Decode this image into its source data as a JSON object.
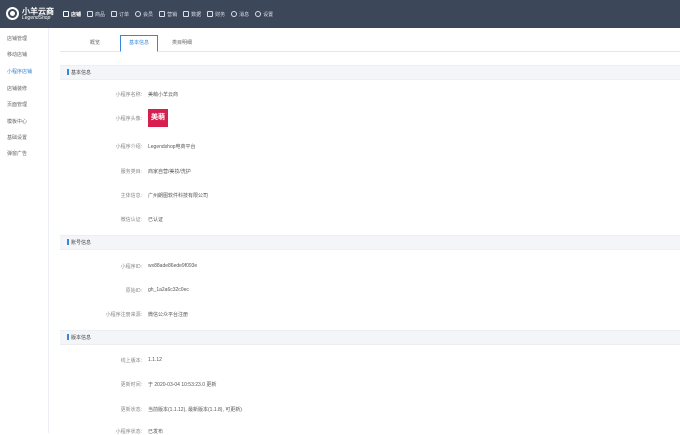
{
  "app": {
    "logo_title": "小羊云商",
    "logo_subtitle": "LegendShop"
  },
  "nav": [
    {
      "label": "店铺",
      "icon": "shop-icon"
    },
    {
      "label": "商品",
      "icon": "goods-icon"
    },
    {
      "label": "订单",
      "icon": "order-icon"
    },
    {
      "label": "会员",
      "icon": "member-icon"
    },
    {
      "label": "营销",
      "icon": "marketing-icon"
    },
    {
      "label": "数据",
      "icon": "data-icon"
    },
    {
      "label": "财务",
      "icon": "finance-icon"
    },
    {
      "label": "消息",
      "icon": "message-icon"
    },
    {
      "label": "设置",
      "icon": "settings-icon"
    }
  ],
  "sidebar": [
    {
      "label": "店铺管理"
    },
    {
      "label": "移动店铺"
    },
    {
      "label": "小程序店铺"
    },
    {
      "label": "店铺装修"
    },
    {
      "label": "页面管理"
    },
    {
      "label": "模板中心"
    },
    {
      "label": "基础设置"
    },
    {
      "label": "弹窗广告"
    }
  ],
  "tabs": [
    {
      "label": "概览"
    },
    {
      "label": "基本信息"
    },
    {
      "label": "类目明细"
    }
  ],
  "basic": {
    "title": "基本信息",
    "name_label": "小程序名称:",
    "name_value": "美萌小羊云商",
    "avatar_label": "小程序头像:",
    "avatar_text": "美萌",
    "intro_label": "小程序介绍:",
    "intro_value": "Legendshop电商平台",
    "category_label": "服务类目:",
    "category_value": "商家自营/美妆/洗护",
    "subject_label": "主体信息:",
    "subject_value": "广州朗图软件科技有限公司",
    "wechat_label": "微信认证:",
    "wechat_value": "已认证"
  },
  "account": {
    "title": "账号信息",
    "appid_label": "小程序ID:",
    "appid_value": "wx88ade86ede9f093e",
    "origin_label": "原始ID:",
    "origin_value": "gh_1a2a6c32c0ec",
    "source_label": "小程序注册来源:",
    "source_value": "微信公众平台注册"
  },
  "version": {
    "title": "版本信息",
    "online_label": "线上版本:",
    "online_value": "1.1.12",
    "update_label": "更新时间:",
    "update_value": "于 2020-03-04 10:53:23.0 更新",
    "status_label": "更新状态:",
    "status_value": "当前版本(1.1.12), 最新版本(1.1.8), 可更新)",
    "extra_label": "小程序状态:",
    "extra_value": "已发布"
  },
  "colors": {
    "topbar": "#3c4759",
    "accent": "#3a86d6",
    "avatar": "#d61f4f"
  }
}
